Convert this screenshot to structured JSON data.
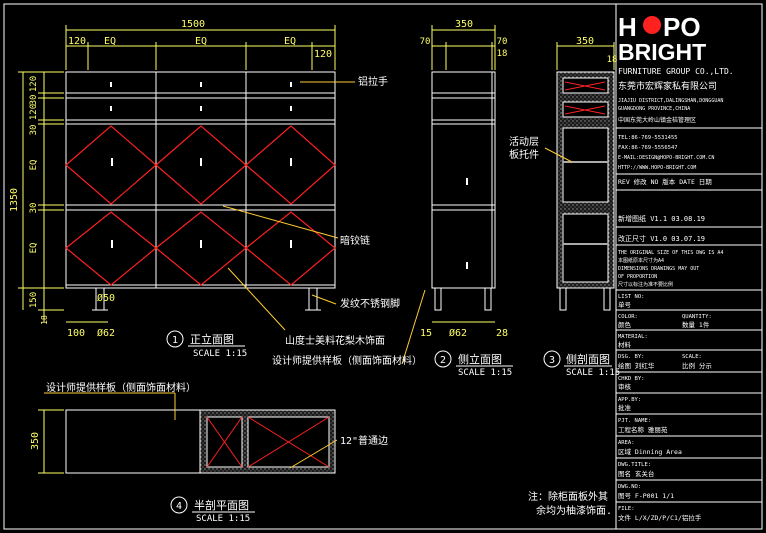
{
  "colors": {
    "background": "#000000",
    "line": "#ffffff",
    "dimension": "#ffff66",
    "pattern": "#ff2020",
    "leader": "#ffcc33",
    "hatch": "#9a9a9a",
    "logo_accent": "#ff2020"
  },
  "front_view": {
    "dim_total_width": "1500",
    "dim_eq": "EQ",
    "dim_side": "120",
    "dim_height": "1350",
    "dim_row_30": "30",
    "dim_row_120": "120",
    "dim_eq_v": "EQ",
    "dim_leg": "150",
    "dim_base": "18",
    "dim_foot_offset": "100",
    "leg_dia": "Ø50",
    "foot_dia": "Ø62",
    "label_handle": "铝拉手",
    "label_mirror": "暗铰链",
    "label_foot": "发纹不锈钢脚",
    "label_veneer": "山度士美料花梨木饰面",
    "label_supply": "设计师提供样板（侧面饰面材料）",
    "title_no": "1",
    "title": "正立面图",
    "scale": "SCALE 1:15"
  },
  "side_view": {
    "dim_depth": "350",
    "dim_70": "70",
    "dim_18": "18",
    "dim_15": "15",
    "foot_dia": "Ø62",
    "dim_28": "28",
    "title_no": "2",
    "title": "侧立面图",
    "scale": "SCALE 1:15"
  },
  "section_view": {
    "dim_depth": "350",
    "dim_18": "18",
    "label_layer": "活动层",
    "label_support": "板托件",
    "title_no": "3",
    "title": "侧剖面图",
    "scale": "SCALE 1:15"
  },
  "plan_view": {
    "label_supply": "设计师提供样板（侧面饰面材料）",
    "dim_depth": "350",
    "label_edge": "12\"普通边",
    "title_no": "4",
    "title": "半剖平面图",
    "scale": "SCALE 1:15"
  },
  "note": {
    "line1": "注：除柜面板外其",
    "line2": "余均为柚漆饰面."
  },
  "title_block": {
    "logo_line1a": "H",
    "logo_line1b": "PO",
    "logo_line2": "BRIGHT",
    "logo_sub": "FURNITURE GROUP CO.,LTD.",
    "company_cn": "东莞市宏辉家私有限公司",
    "addr1": "JIAJIU DISTRICT,DALINGSHAN,DONGGUAN",
    "addr2": "GUANGDONG PROVINCE,CHINA",
    "addr_cn": "中国东莞大岭山镇金桔管理区",
    "tel": "TEL:86-769-5531455",
    "fax": "FAX:86-769-5556547",
    "email": "E-MAIL:DESIGN@HOPO-BRIGHT.COM.CN",
    "http": "HTTP://WWW.HOPO-BRIGHT.COM",
    "rev_header": "REV 修改    NO 版本    DATE 日期",
    "rev1": "新增图纸    V1.1    03.08.19",
    "rev2": "改正尺寸    V1.0    03.07.19",
    "orig1": "THE ORIGINAL SIZE OF THIS DWG IS A4",
    "orig2": "本图纸原本尺寸为A4",
    "orig3": "DIMENSIONS DRAWINGS MAY OUT",
    "orig4": "OF PROPORTION",
    "orig5": "尺寸以标注为准不要比例",
    "list_no_label": "LIST NO:",
    "list_no_cn": "单号",
    "color_label": "COLOR:",
    "color_cn": "颜色",
    "quantity_label": "QUANTITY:",
    "quantity_cn": "数量  1件",
    "material_label": "MATERIAL:",
    "material_cn": "材料",
    "dsg_label": "DSG. BY:",
    "dsg_cn": "绘图  刘红华",
    "scale_label": "SCALE:",
    "scale_cn": "比例  分示",
    "chkd_label": "CHKD BY:",
    "chkd_cn": "审核",
    "appby_label": "APP.BY:",
    "appby_cn": "批准",
    "pjt_label": "PJT. NAME:",
    "pjt_cn": "工程名称    雅丽苑",
    "area_label": "AREA:",
    "area_cn": "区域    Dinning Area",
    "dwg_title_label": "DWG.TITLE:",
    "dwg_title_cn": "图名      玄关台",
    "dwg_no_label": "DWG.NO:",
    "dwg_no_cn": "图号    F-P001      1/1",
    "file_label": "FILE:",
    "file_cn": "文件  L/X/ZD/P/C1/铝拉手"
  }
}
